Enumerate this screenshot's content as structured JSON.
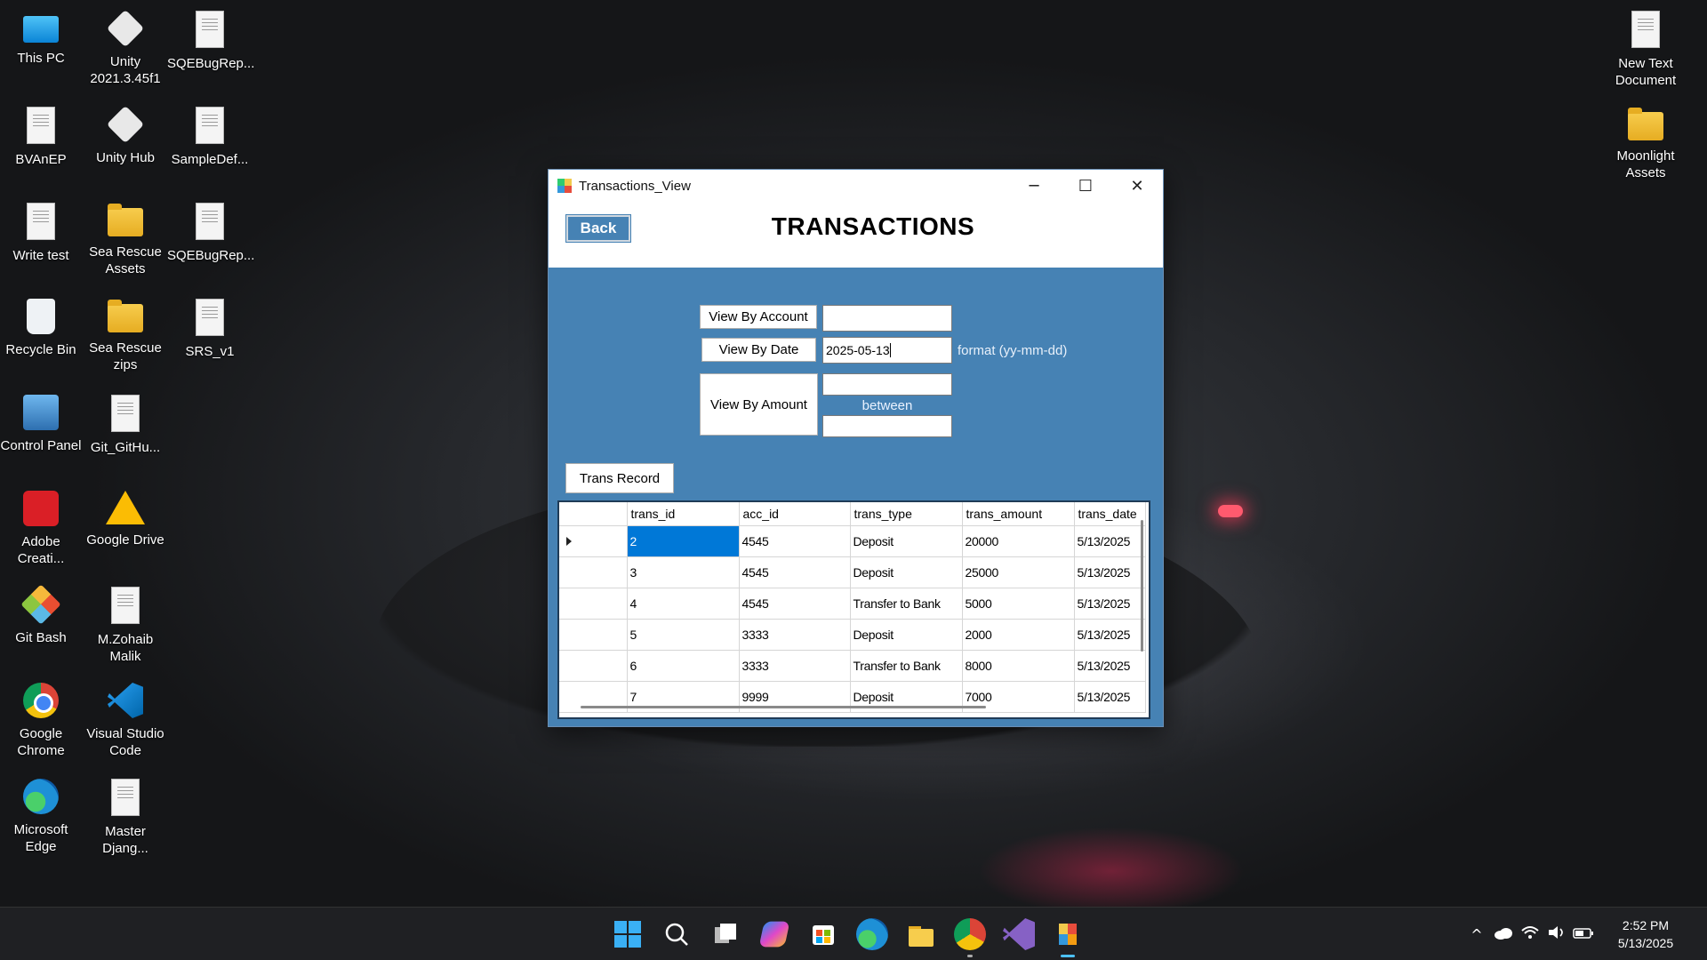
{
  "desktop": {
    "icons": [
      {
        "label": "This PC",
        "kind": "pc"
      },
      {
        "label": "Unity 2021.3.45f1",
        "kind": "unity"
      },
      {
        "label": "SQEBugRep...",
        "kind": "doc"
      },
      {
        "label": "BVAnEP",
        "kind": "doc"
      },
      {
        "label": "Unity Hub",
        "kind": "unity"
      },
      {
        "label": "SampleDef...",
        "kind": "doc"
      },
      {
        "label": "Write test",
        "kind": "doc"
      },
      {
        "label": "Sea Rescue Assets",
        "kind": "folder"
      },
      {
        "label": "SQEBugRep...",
        "kind": "doc"
      },
      {
        "label": "Recycle Bin",
        "kind": "bin"
      },
      {
        "label": "Sea Rescue zips",
        "kind": "folder"
      },
      {
        "label": "SRS_v1",
        "kind": "doc"
      },
      {
        "label": "Control Panel",
        "kind": "cp"
      },
      {
        "label": "Git_GitHu...",
        "kind": "doc"
      },
      {
        "label": "Adobe Creati...",
        "kind": "adobe"
      },
      {
        "label": "Google Drive",
        "kind": "gdrive"
      },
      {
        "label": "Git Bash",
        "kind": "git"
      },
      {
        "label": "M.Zohaib Malik",
        "kind": "doc"
      },
      {
        "label": "Google Chrome",
        "kind": "chrome"
      },
      {
        "label": "Visual Studio Code",
        "kind": "vscode"
      },
      {
        "label": "Microsoft Edge",
        "kind": "edge"
      },
      {
        "label": "Master Djang...",
        "kind": "doc"
      },
      {
        "label": "New Text Document",
        "kind": "doc"
      },
      {
        "label": "Moonlight Assets",
        "kind": "folder"
      }
    ]
  },
  "window": {
    "title": "Transactions_View",
    "controls": {
      "minimize": "─",
      "maximize": "☐",
      "close": "✕"
    },
    "back_label": "Back",
    "heading": "TRANSACTIONS",
    "view_by_account_label": "View By Account",
    "account_value": "",
    "view_by_date_label": "View By Date",
    "date_value": "2025-05-13",
    "date_format_hint": "format (yy-mm-dd)",
    "view_by_amount_label": "View By Amount",
    "amount_min_value": "",
    "between_label": "between",
    "amount_max_value": "",
    "trans_record_label": "Trans Record",
    "grid": {
      "columns": [
        "trans_id",
        "acc_id",
        "trans_type",
        "trans_amount",
        "trans_date"
      ],
      "rows": [
        [
          "2",
          "4545",
          "Deposit",
          "20000",
          "5/13/2025"
        ],
        [
          "3",
          "4545",
          "Deposit",
          "25000",
          "5/13/2025"
        ],
        [
          "4",
          "4545",
          "Transfer to Bank",
          "5000",
          "5/13/2025"
        ],
        [
          "5",
          "3333",
          "Deposit",
          "2000",
          "5/13/2025"
        ],
        [
          "6",
          "3333",
          "Transfer to Bank",
          "8000",
          "5/13/2025"
        ],
        [
          "7",
          "9999",
          "Deposit",
          "7000",
          "5/13/2025"
        ]
      ]
    }
  },
  "taskbar": {
    "apps": [
      "start-icon",
      "search-icon",
      "task-view-icon",
      "copilot-icon",
      "store-icon",
      "edge-icon",
      "file-explorer-icon",
      "chrome-icon",
      "visual-studio-icon",
      "transactions-app-icon"
    ],
    "tray": {
      "chevron": "^",
      "time": "2:52 PM",
      "date": "5/13/2025"
    }
  }
}
